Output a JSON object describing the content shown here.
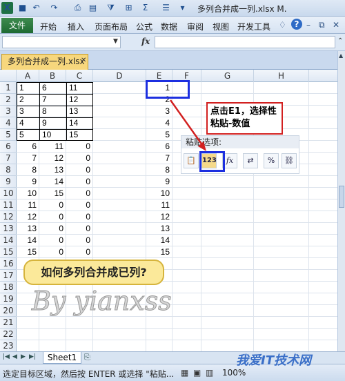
{
  "window": {
    "title": "多列合并成一列.xlsx M.",
    "app_icon": "excel-icon"
  },
  "quick_access": [
    "save-icon",
    "undo-icon",
    "redo-icon",
    "print-preview-icon",
    "paste-icon",
    "filter-icon",
    "borders-icon",
    "sum-icon",
    "align-icon"
  ],
  "ribbon": {
    "file_tab": "文件",
    "tabs": [
      "开始",
      "插入",
      "页面布局",
      "公式",
      "数据",
      "审阅",
      "视图",
      "开发工具"
    ]
  },
  "formula_bar": {
    "name_box": "",
    "fx_label": "fx",
    "content": ""
  },
  "document_tab": {
    "label": "多列合并成一列.xlsx"
  },
  "columns": [
    "A",
    "B",
    "C",
    "D",
    "E",
    "F",
    "G",
    "H"
  ],
  "rows": [
    "1",
    "2",
    "3",
    "4",
    "5",
    "6",
    "7",
    "8",
    "9",
    "10",
    "11",
    "12",
    "13",
    "14",
    "15",
    "16",
    "17",
    "18",
    "19",
    "20",
    "21",
    "22",
    "23"
  ],
  "cells": {
    "A": [
      "1",
      "2",
      "3",
      "4",
      "5",
      "6",
      "7",
      "8",
      "9",
      "10",
      "11",
      "12",
      "13",
      "14",
      "15"
    ],
    "B": [
      "6",
      "7",
      "8",
      "9",
      "10",
      "11",
      "12",
      "13",
      "14",
      "15",
      "0",
      "0",
      "0",
      "0",
      "0"
    ],
    "C": [
      "11",
      "12",
      "13",
      "14",
      "15",
      "0",
      "0",
      "0",
      "0",
      "0",
      "0",
      "0",
      "0",
      "0",
      "0"
    ],
    "E": [
      "1",
      "2",
      "3",
      "4",
      "5",
      "6",
      "7",
      "8",
      "9",
      "10",
      "11",
      "12",
      "13",
      "14",
      "15"
    ]
  },
  "paste_options": {
    "label": "粘贴选项:",
    "buttons": [
      "paste-icon",
      "123",
      "fx",
      "transpose-icon",
      "percent-format-icon",
      "link-icon"
    ]
  },
  "callout": {
    "text": "点击E1，选择性粘贴-数值"
  },
  "question": {
    "text": "如何多列合并成已列?"
  },
  "watermark": {
    "text": "By yianxss"
  },
  "site_watermark": {
    "text": "我爱IT技术网"
  },
  "sheet_tabs": {
    "active": "Sheet1"
  },
  "status_bar": {
    "message": "选定目标区域，然后按 ENTER 或选择 \"粘贴...",
    "zoom": "100%"
  },
  "colors": {
    "selection_box": "#1c2fe0",
    "callout_border": "#d22020",
    "question_fill": "#fbe99a",
    "excel_green": "#1e7145"
  }
}
